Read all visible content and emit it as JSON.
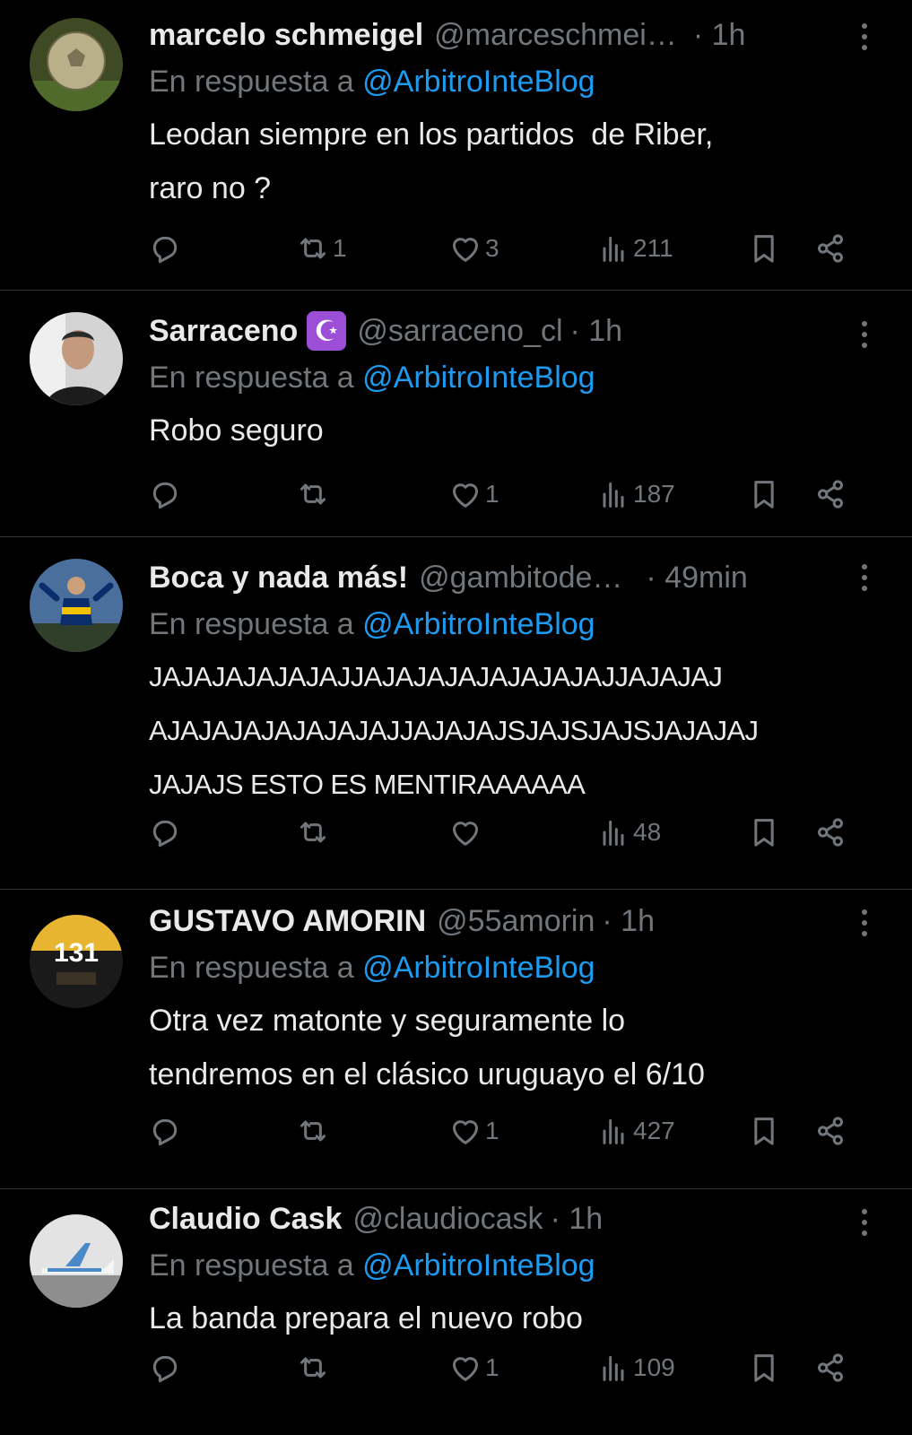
{
  "tweets": [
    {
      "name": "marcelo schmeigel",
      "handle": "@marceschmei…",
      "time": "· 1h",
      "reply_prefix": "En respuesta a",
      "reply_to": "@ArbitroInteBlog",
      "text": "Leodan siempre en los partidos  de Riber,\nraro no ?",
      "retweets": "1",
      "likes": "3",
      "views": "211",
      "colors": {
        "avatar": "#5b6b3c"
      }
    },
    {
      "name": "Sarraceno",
      "badge": "☪",
      "handle": "@sarraceno_cl",
      "time": "· 1h",
      "reply_prefix": "En respuesta a",
      "reply_to": "@ArbitroInteBlog",
      "text": "Robo seguro",
      "retweets": "",
      "likes": "1",
      "views": "187",
      "colors": {
        "avatar": "#cfcfcf"
      }
    },
    {
      "name": "Boca y nada más!",
      "handle": "@gambitode…",
      "time": "· 49min",
      "reply_prefix": "En respuesta a",
      "reply_to": "@ArbitroInteBlog",
      "text": "JAJAJAJAJAJAJJAJAJAJAJAJAJAJAJJAJAJAJ\nAJAJAJAJAJAJAJAJJAJAJAJSJAJSJAJSJAJAJAJ\nJAJAJS ESTO ES MENTIRAAAAAA",
      "retweets": "",
      "likes": "",
      "views": "48",
      "colors": {
        "avatar": "#3b5f8f"
      }
    },
    {
      "name": "GUSTAVO AMORIN",
      "handle": "@55amorin",
      "time": "· 1h",
      "reply_prefix": "En respuesta a",
      "reply_to": "@ArbitroInteBlog",
      "text": "Otra vez matonte y seguramente lo\ntendremos en el clásico uruguayo el 6/10",
      "retweets": "",
      "likes": "1",
      "views": "427",
      "avatar_text": "131",
      "colors": {
        "avatar": "#1a1a1a",
        "logo": "#e8b530"
      }
    },
    {
      "name": "Claudio Cask",
      "handle": "@claudiocask",
      "time": "· 1h",
      "reply_prefix": "En respuesta a",
      "reply_to": "@ArbitroInteBlog",
      "text": "La banda prepara el nuevo robo",
      "retweets": "",
      "likes": "1",
      "views": "109",
      "colors": {
        "avatar": "#d9d9d9"
      }
    }
  ],
  "icons": [
    "reply-icon",
    "retweet-icon",
    "like-icon",
    "views-icon",
    "bookmark-icon",
    "share-icon",
    "more-icon"
  ],
  "colors": {
    "background": "#000000",
    "text": "#e7e9ea",
    "muted": "#71767b",
    "link": "#1d9bf0",
    "divider": "#2f3336"
  }
}
